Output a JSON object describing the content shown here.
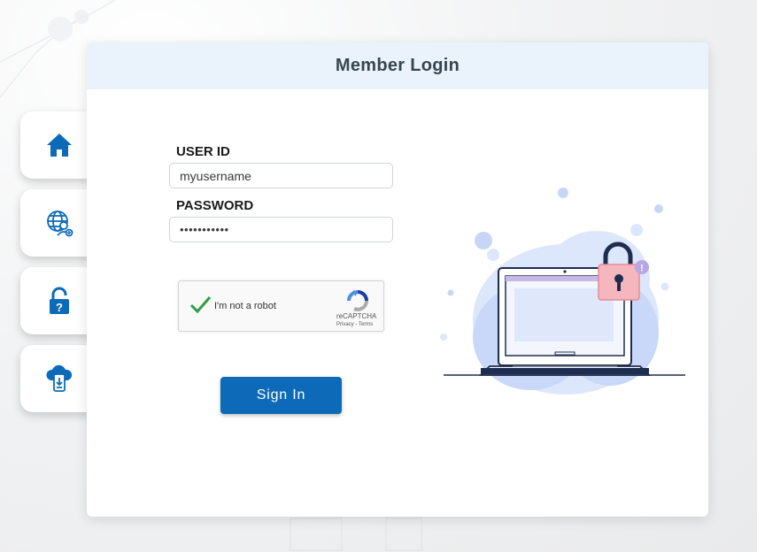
{
  "login": {
    "title": "Member Login",
    "user_id_label": "USER ID",
    "user_id_value": "myusername",
    "password_label": "PASSWORD",
    "password_value": "•••••••••••",
    "signin_label": "Sign In"
  },
  "captcha": {
    "label": "I'm not a robot",
    "brand": "reCAPTCHA",
    "links": "Privacy - Terms"
  },
  "side_nav": {
    "items": [
      {
        "icon": "home-icon"
      },
      {
        "icon": "globe-user-icon"
      },
      {
        "icon": "padlock-question-icon"
      },
      {
        "icon": "cloud-download-icon"
      }
    ]
  },
  "colors": {
    "accent": "#0d6ab8",
    "header_bg": "#eaf3fb",
    "lock": "#f5b6bd"
  }
}
